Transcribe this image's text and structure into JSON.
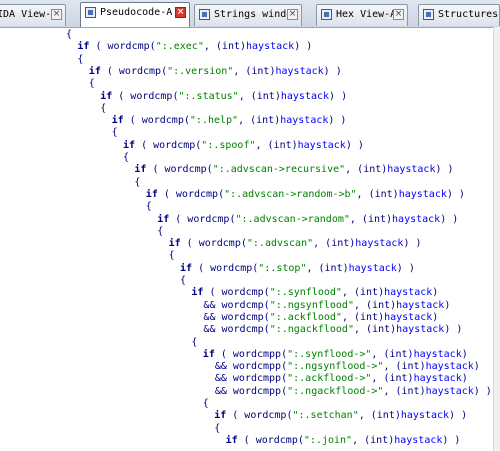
{
  "tabs": [
    {
      "label": "IDA View-A",
      "active": false,
      "icon": "disassembly-icon"
    },
    {
      "label": "Pseudocode-A",
      "active": true,
      "icon": "pseudocode-icon"
    },
    {
      "label": "Strings window",
      "active": false,
      "icon": "strings-icon"
    },
    {
      "label": "Hex View-A",
      "active": false,
      "icon": "hex-icon"
    },
    {
      "label": "Structures",
      "active": false,
      "icon": "structures-icon"
    }
  ],
  "close_glyph": "×",
  "colors": {
    "keyword": "#000080",
    "string": "#008000",
    "variable": "#0000ff",
    "active_close": "#d63a2a"
  },
  "code_lines": [
    {
      "indent": 0,
      "parts": [
        [
          "p",
          "{"
        ]
      ]
    },
    {
      "indent": 1,
      "parts": [
        [
          "kw",
          "if"
        ],
        [
          "p",
          " ( "
        ],
        [
          "fn",
          "wordcmp"
        ],
        [
          "p",
          "("
        ],
        [
          "str",
          "\":.exec\""
        ],
        [
          "p",
          ", ("
        ],
        [
          "cast",
          "int"
        ],
        [
          "p",
          ")"
        ],
        [
          "var",
          "haystack"
        ],
        [
          "p",
          ") )"
        ]
      ]
    },
    {
      "indent": 1,
      "parts": [
        [
          "p",
          "{"
        ]
      ]
    },
    {
      "indent": 2,
      "parts": [
        [
          "kw",
          "if"
        ],
        [
          "p",
          " ( "
        ],
        [
          "fn",
          "wordcmp"
        ],
        [
          "p",
          "("
        ],
        [
          "str",
          "\":.version\""
        ],
        [
          "p",
          ", ("
        ],
        [
          "cast",
          "int"
        ],
        [
          "p",
          ")"
        ],
        [
          "var",
          "haystack"
        ],
        [
          "p",
          ") )"
        ]
      ]
    },
    {
      "indent": 2,
      "parts": [
        [
          "p",
          "{"
        ]
      ]
    },
    {
      "indent": 3,
      "parts": [
        [
          "kw",
          "if"
        ],
        [
          "p",
          " ( "
        ],
        [
          "fn",
          "wordcmp"
        ],
        [
          "p",
          "("
        ],
        [
          "str",
          "\":.status\""
        ],
        [
          "p",
          ", ("
        ],
        [
          "cast",
          "int"
        ],
        [
          "p",
          ")"
        ],
        [
          "var",
          "haystack"
        ],
        [
          "p",
          ") )"
        ]
      ]
    },
    {
      "indent": 3,
      "parts": [
        [
          "p",
          "{"
        ]
      ]
    },
    {
      "indent": 4,
      "parts": [
        [
          "kw",
          "if"
        ],
        [
          "p",
          " ( "
        ],
        [
          "fn",
          "wordcmp"
        ],
        [
          "p",
          "("
        ],
        [
          "str",
          "\":.help\""
        ],
        [
          "p",
          ", ("
        ],
        [
          "cast",
          "int"
        ],
        [
          "p",
          ")"
        ],
        [
          "var",
          "haystack"
        ],
        [
          "p",
          ") )"
        ]
      ]
    },
    {
      "indent": 4,
      "parts": [
        [
          "p",
          "{"
        ]
      ]
    },
    {
      "indent": 5,
      "parts": [
        [
          "kw",
          "if"
        ],
        [
          "p",
          " ( "
        ],
        [
          "fn",
          "wordcmp"
        ],
        [
          "p",
          "("
        ],
        [
          "str",
          "\":.spoof\""
        ],
        [
          "p",
          ", ("
        ],
        [
          "cast",
          "int"
        ],
        [
          "p",
          ")"
        ],
        [
          "var",
          "haystack"
        ],
        [
          "p",
          ") )"
        ]
      ]
    },
    {
      "indent": 5,
      "parts": [
        [
          "p",
          "{"
        ]
      ]
    },
    {
      "indent": 6,
      "parts": [
        [
          "kw",
          "if"
        ],
        [
          "p",
          " ( "
        ],
        [
          "fn",
          "wordcmp"
        ],
        [
          "p",
          "("
        ],
        [
          "str",
          "\":.advscan->recursive\""
        ],
        [
          "p",
          ", ("
        ],
        [
          "cast",
          "int"
        ],
        [
          "p",
          ")"
        ],
        [
          "var",
          "haystack"
        ],
        [
          "p",
          ") )"
        ]
      ]
    },
    {
      "indent": 6,
      "parts": [
        [
          "p",
          "{"
        ]
      ]
    },
    {
      "indent": 7,
      "parts": [
        [
          "kw",
          "if"
        ],
        [
          "p",
          " ( "
        ],
        [
          "fn",
          "wordcmp"
        ],
        [
          "p",
          "("
        ],
        [
          "str",
          "\":.advscan->random->b\""
        ],
        [
          "p",
          ", ("
        ],
        [
          "cast",
          "int"
        ],
        [
          "p",
          ")"
        ],
        [
          "var",
          "haystack"
        ],
        [
          "p",
          ") )"
        ]
      ]
    },
    {
      "indent": 7,
      "parts": [
        [
          "p",
          "{"
        ]
      ]
    },
    {
      "indent": 8,
      "parts": [
        [
          "kw",
          "if"
        ],
        [
          "p",
          " ( "
        ],
        [
          "fn",
          "wordcmp"
        ],
        [
          "p",
          "("
        ],
        [
          "str",
          "\":.advscan->random\""
        ],
        [
          "p",
          ", ("
        ],
        [
          "cast",
          "int"
        ],
        [
          "p",
          ")"
        ],
        [
          "var",
          "haystack"
        ],
        [
          "p",
          ") )"
        ]
      ]
    },
    {
      "indent": 8,
      "parts": [
        [
          "p",
          "{"
        ]
      ]
    },
    {
      "indent": 9,
      "parts": [
        [
          "kw",
          "if"
        ],
        [
          "p",
          " ( "
        ],
        [
          "fn",
          "wordcmp"
        ],
        [
          "p",
          "("
        ],
        [
          "str",
          "\":.advscan\""
        ],
        [
          "p",
          ", ("
        ],
        [
          "cast",
          "int"
        ],
        [
          "p",
          ")"
        ],
        [
          "var",
          "haystack"
        ],
        [
          "p",
          ") )"
        ]
      ]
    },
    {
      "indent": 9,
      "parts": [
        [
          "p",
          "{"
        ]
      ]
    },
    {
      "indent": 10,
      "parts": [
        [
          "kw",
          "if"
        ],
        [
          "p",
          " ( "
        ],
        [
          "fn",
          "wordcmp"
        ],
        [
          "p",
          "("
        ],
        [
          "str",
          "\":.stop\""
        ],
        [
          "p",
          ", ("
        ],
        [
          "cast",
          "int"
        ],
        [
          "p",
          ")"
        ],
        [
          "var",
          "haystack"
        ],
        [
          "p",
          ") )"
        ]
      ]
    },
    {
      "indent": 10,
      "parts": [
        [
          "p",
          "{"
        ]
      ]
    },
    {
      "indent": 11,
      "parts": [
        [
          "kw",
          "if"
        ],
        [
          "p",
          " ( "
        ],
        [
          "fn",
          "wordcmp"
        ],
        [
          "p",
          "("
        ],
        [
          "str",
          "\":.synflood\""
        ],
        [
          "p",
          ", ("
        ],
        [
          "cast",
          "int"
        ],
        [
          "p",
          ")"
        ],
        [
          "var",
          "haystack"
        ],
        [
          "p",
          ")"
        ]
      ]
    },
    {
      "indent": 11,
      "parts": [
        [
          "p",
          "  && "
        ],
        [
          "fn",
          "wordcmp"
        ],
        [
          "p",
          "("
        ],
        [
          "str",
          "\":.ngsynflood\""
        ],
        [
          "p",
          ", ("
        ],
        [
          "cast",
          "int"
        ],
        [
          "p",
          ")"
        ],
        [
          "var",
          "haystack"
        ],
        [
          "p",
          ")"
        ]
      ]
    },
    {
      "indent": 11,
      "parts": [
        [
          "p",
          "  && "
        ],
        [
          "fn",
          "wordcmp"
        ],
        [
          "p",
          "("
        ],
        [
          "str",
          "\":.ackflood\""
        ],
        [
          "p",
          ", ("
        ],
        [
          "cast",
          "int"
        ],
        [
          "p",
          ")"
        ],
        [
          "var",
          "haystack"
        ],
        [
          "p",
          ")"
        ]
      ]
    },
    {
      "indent": 11,
      "parts": [
        [
          "p",
          "  && "
        ],
        [
          "fn",
          "wordcmp"
        ],
        [
          "p",
          "("
        ],
        [
          "str",
          "\":.ngackflood\""
        ],
        [
          "p",
          ", ("
        ],
        [
          "cast",
          "int"
        ],
        [
          "p",
          ")"
        ],
        [
          "var",
          "haystack"
        ],
        [
          "p",
          ") )"
        ]
      ]
    },
    {
      "indent": 11,
      "parts": [
        [
          "p",
          "{"
        ]
      ]
    },
    {
      "indent": 12,
      "parts": [
        [
          "kw",
          "if"
        ],
        [
          "p",
          " ( "
        ],
        [
          "fn",
          "wordcmpp"
        ],
        [
          "p",
          "("
        ],
        [
          "str",
          "\":.synflood->\""
        ],
        [
          "p",
          ", ("
        ],
        [
          "cast",
          "int"
        ],
        [
          "p",
          ")"
        ],
        [
          "var",
          "haystack"
        ],
        [
          "p",
          ")"
        ]
      ]
    },
    {
      "indent": 12,
      "parts": [
        [
          "p",
          "  && "
        ],
        [
          "fn",
          "wordcmpp"
        ],
        [
          "p",
          "("
        ],
        [
          "str",
          "\":.ngsynflood->\""
        ],
        [
          "p",
          ", ("
        ],
        [
          "cast",
          "int"
        ],
        [
          "p",
          ")"
        ],
        [
          "var",
          "haystack"
        ],
        [
          "p",
          ")"
        ]
      ]
    },
    {
      "indent": 12,
      "parts": [
        [
          "p",
          "  && "
        ],
        [
          "fn",
          "wordcmpp"
        ],
        [
          "p",
          "("
        ],
        [
          "str",
          "\":.ackflood->\""
        ],
        [
          "p",
          ", ("
        ],
        [
          "cast",
          "int"
        ],
        [
          "p",
          ")"
        ],
        [
          "var",
          "haystack"
        ],
        [
          "p",
          ")"
        ]
      ]
    },
    {
      "indent": 12,
      "parts": [
        [
          "p",
          "  && "
        ],
        [
          "fn",
          "wordcmpp"
        ],
        [
          "p",
          "("
        ],
        [
          "str",
          "\":.ngackflood->\""
        ],
        [
          "p",
          ", ("
        ],
        [
          "cast",
          "int"
        ],
        [
          "p",
          ")"
        ],
        [
          "var",
          "haystack"
        ],
        [
          "p",
          ") )"
        ]
      ]
    },
    {
      "indent": 12,
      "parts": [
        [
          "p",
          "{"
        ]
      ]
    },
    {
      "indent": 13,
      "parts": [
        [
          "kw",
          "if"
        ],
        [
          "p",
          " ( "
        ],
        [
          "fn",
          "wordcmp"
        ],
        [
          "p",
          "("
        ],
        [
          "str",
          "\":.setchan\""
        ],
        [
          "p",
          ", ("
        ],
        [
          "cast",
          "int"
        ],
        [
          "p",
          ")"
        ],
        [
          "var",
          "haystack"
        ],
        [
          "p",
          ") )"
        ]
      ]
    },
    {
      "indent": 13,
      "parts": [
        [
          "p",
          "{"
        ]
      ]
    },
    {
      "indent": 14,
      "parts": [
        [
          "kw",
          "if"
        ],
        [
          "p",
          " ( "
        ],
        [
          "fn",
          "wordcmp"
        ],
        [
          "p",
          "("
        ],
        [
          "str",
          "\":.join\""
        ],
        [
          "p",
          ", ("
        ],
        [
          "cast",
          "int"
        ],
        [
          "p",
          ")"
        ],
        [
          "var",
          "haystack"
        ],
        [
          "p",
          ") )"
        ]
      ]
    }
  ]
}
